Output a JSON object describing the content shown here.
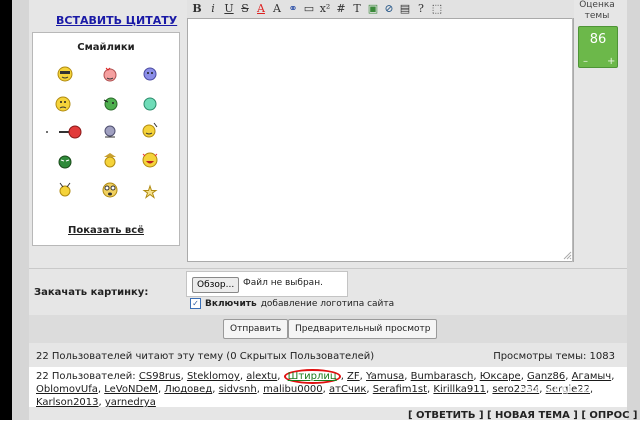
{
  "quote_link": "ВСТАВИТЬ ЦИТАТУ",
  "smileys": {
    "title": "Смайлики",
    "show_all": "Показать всё"
  },
  "rating": {
    "label": "Оценка темы",
    "value": "86",
    "minus": "–",
    "plus": "+"
  },
  "toolbar": [
    "B",
    "i",
    "U",
    "S",
    "A",
    "A",
    "⚭",
    "▭",
    "x²",
    "#",
    "T",
    "▣",
    "⊘",
    "▤",
    "?",
    "⬚"
  ],
  "upload": {
    "label": "Закачать картинку:",
    "browse": "Обзор...",
    "no_file": "Файл не выбран.",
    "logo_checkbox_bold": "Включить",
    "logo_checkbox_rest": "добавление логотипа сайта"
  },
  "buttons": {
    "send": "Отправить",
    "preview": "Предварительный просмотр"
  },
  "info": {
    "readers": "22 Пользователей читают эту тему (0 Скрытых Пользователей)",
    "views": "Просмотры темы: 1083"
  },
  "users": {
    "prefix": "22 Пользователей:",
    "list": [
      "CS98rus",
      "Steklomoy",
      "alextu",
      "Штирлиц",
      "ZF",
      "Yamusa",
      "Bumbarasch",
      "Юкcape",
      "Ganz86",
      "Агамыч",
      "OblomovUfa",
      "LeVoNDeM",
      "Людовед",
      "sidvsnh",
      "malibu0000",
      "атСчик",
      "Serafim1st",
      "Kirillka911",
      "sero2334",
      "Sergie22",
      "Karlson2013",
      "yarnedrya"
    ]
  },
  "bottom": "[ ОТВЕТИТЬ ] [ НОВАЯ ТЕМА ] [ ОПРОС ]",
  "watermark": "YAPLAKAL.COM"
}
